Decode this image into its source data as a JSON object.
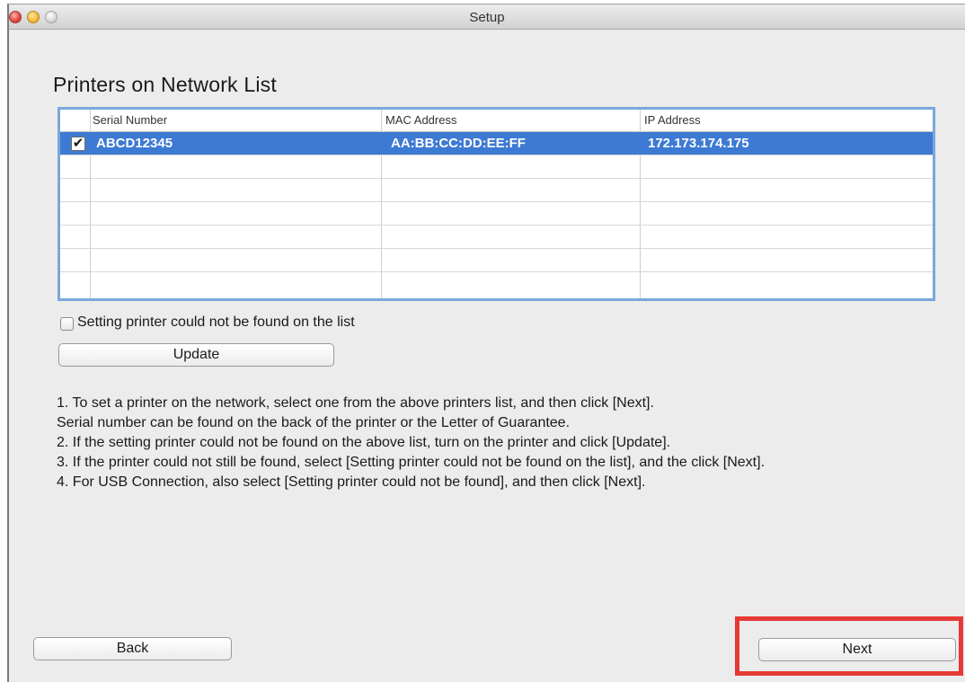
{
  "window": {
    "title": "Setup"
  },
  "page": {
    "heading": "Printers on Network List"
  },
  "table": {
    "columns": [
      "Serial Number",
      "MAC Address",
      "IP Address"
    ],
    "rows": [
      {
        "checked": true,
        "check_glyph": "✔",
        "serial": "ABCD12345",
        "mac": "AA:BB:CC:DD:EE:FF",
        "ip": "172.173.174.175"
      }
    ],
    "empty_rows": 6
  },
  "not_found_option": {
    "label": "Setting printer could not be found on the list",
    "checked": false
  },
  "buttons": {
    "update": "Update",
    "back": "Back",
    "next": "Next"
  },
  "instructions": [
    "1. To set a printer on the network, select one from the above printers list, and then click [Next].",
    "Serial number can be found on the back of the printer or the Letter of Guarantee.",
    "2. If the setting printer could not be found on the above list, turn on the printer and click [Update].",
    "3. If the printer could not still be found, select [Setting printer could not be found on the list], and the click [Next].",
    "4. For USB Connection, also select [Setting printer could not be found], and then click [Next]."
  ],
  "colors": {
    "selection": "#3d7ad4",
    "table_border": "#7aa7dc",
    "highlight": "#e53935"
  }
}
